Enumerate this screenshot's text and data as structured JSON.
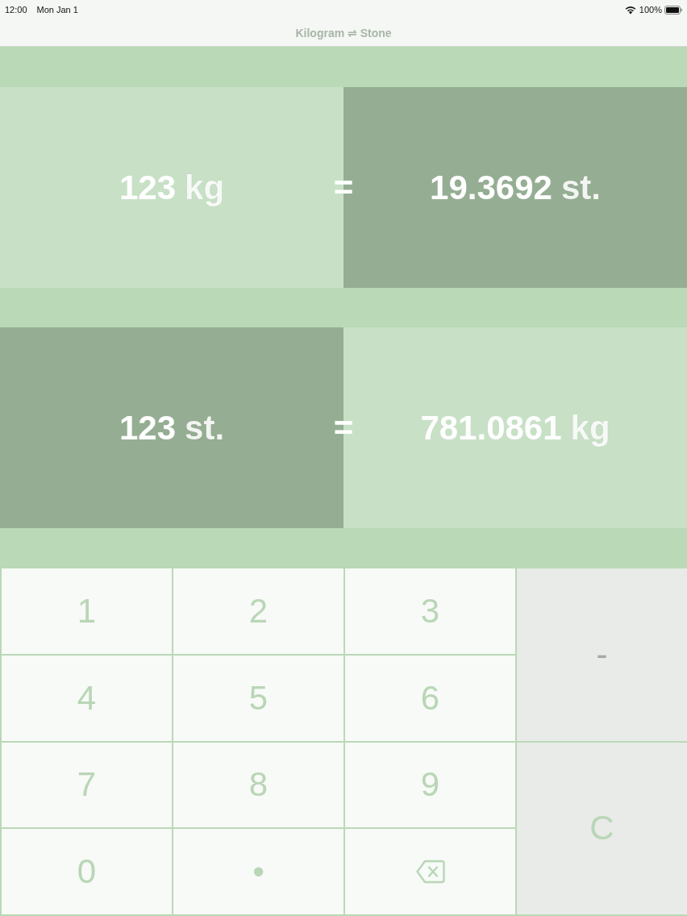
{
  "status_bar": {
    "time": "12:00",
    "date": "Mon Jan 1",
    "battery": "100%"
  },
  "nav_bar": {
    "title": "Kilogram ⇌ Stone"
  },
  "conversions": [
    {
      "from": {
        "value": "123",
        "unit": "kg",
        "color": "#c8e1c6"
      },
      "equals": "=",
      "to": {
        "value": "19.3692",
        "unit": "st.",
        "color": "#95ae93"
      }
    },
    {
      "from": {
        "value": "123",
        "unit": "st.",
        "color": "#95ae93"
      },
      "equals": "=",
      "to": {
        "value": "781.0861",
        "unit": "kg",
        "color": "#c8e1c6"
      }
    }
  ],
  "keypad": [
    {
      "label": "1",
      "kind": "digit"
    },
    {
      "label": "2",
      "kind": "digit"
    },
    {
      "label": "3",
      "kind": "digit"
    },
    {
      "label": "-",
      "kind": "sign"
    },
    {
      "label": "4",
      "kind": "digit"
    },
    {
      "label": "5",
      "kind": "digit"
    },
    {
      "label": "6",
      "kind": "digit"
    },
    {
      "label": "7",
      "kind": "digit"
    },
    {
      "label": "8",
      "kind": "digit"
    },
    {
      "label": "9",
      "kind": "digit"
    },
    {
      "label": "C",
      "kind": "clear"
    },
    {
      "label": "0",
      "kind": "digit"
    },
    {
      "label": "•",
      "kind": "decimal"
    },
    {
      "kind": "backspace"
    }
  ]
}
